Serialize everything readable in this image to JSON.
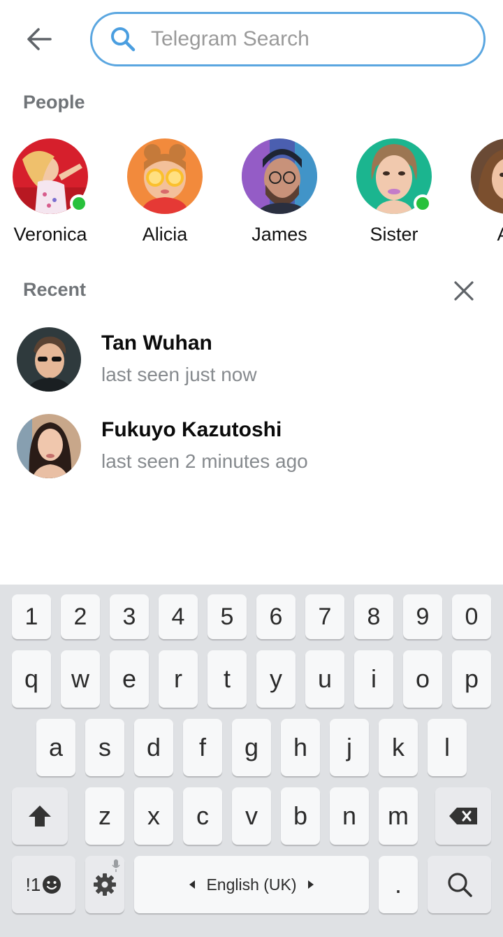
{
  "search": {
    "placeholder": "Telegram Search",
    "value": ""
  },
  "sections": {
    "people": "People",
    "recent": "Recent"
  },
  "people": [
    {
      "name": "Veronica",
      "online": true
    },
    {
      "name": "Alicia",
      "online": false
    },
    {
      "name": "James",
      "online": false
    },
    {
      "name": "Sister",
      "online": true
    },
    {
      "name": "Ad",
      "online": false
    }
  ],
  "recent": [
    {
      "name": "Tan Wuhan",
      "status": "last seen just now"
    },
    {
      "name": "Fukuyo Kazutoshi",
      "status": "last seen 2 minutes ago"
    }
  ],
  "keyboard": {
    "numbers": [
      "1",
      "2",
      "3",
      "4",
      "5",
      "6",
      "7",
      "8",
      "9",
      "0"
    ],
    "row1": [
      "q",
      "w",
      "e",
      "r",
      "t",
      "y",
      "u",
      "i",
      "o",
      "p"
    ],
    "row2": [
      "a",
      "s",
      "d",
      "f",
      "g",
      "h",
      "j",
      "k",
      "l"
    ],
    "row3": [
      "z",
      "x",
      "c",
      "v",
      "b",
      "n",
      "m"
    ],
    "symbols_label": "!1",
    "language_label": "English (UK)",
    "period": "."
  },
  "colors": {
    "accent": "#5aa6e0",
    "online": "#28c13c",
    "keyboard_bg": "#dfe1e4"
  },
  "icons": [
    "back-arrow-icon",
    "search-icon",
    "close-icon",
    "shift-icon",
    "backspace-icon",
    "emoji-icon",
    "settings-icon",
    "microphone-icon",
    "search-icon"
  ]
}
